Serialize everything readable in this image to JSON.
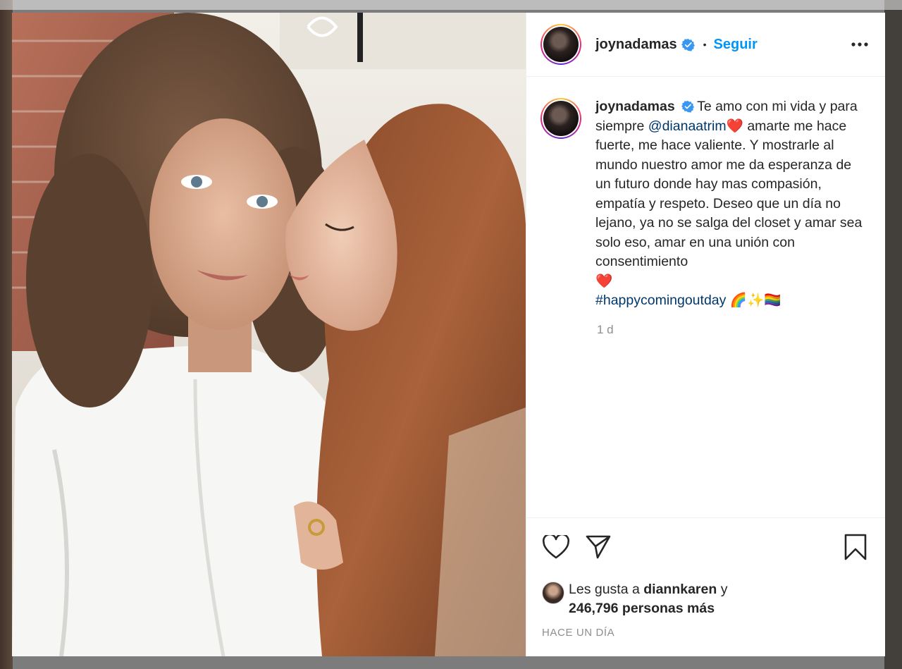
{
  "post": {
    "username": "joynadamas",
    "follow_label": "Seguir",
    "separator": "•",
    "caption": {
      "part1": "Te amo con mi vida y para siempre ",
      "mention": "@dianaatrim",
      "heart1": "❤️",
      "part2": " amarte me hace fuerte, me hace valiente. Y mostrarle al mundo nuestro amor me da esperanza de un futuro donde hay mas compasión, empatía y respeto. Deseo que un día no lejano, ya no se salga del closet y amar sea solo eso, amar en una unión con consentimiento",
      "heart2": "❤️",
      "hashtag": "#happycomingoutday",
      "emojis": "🌈✨🏳️‍🌈"
    },
    "caption_time": "1 d",
    "likes": {
      "prefix": "Les gusta a",
      "liker": "diannkaren",
      "connector": "y",
      "count_text": "246,796 personas más"
    },
    "posted_ago": "HACE UN DÍA"
  },
  "icons": {
    "verified": "verified-badge-icon",
    "more": "more-options-icon",
    "like": "heart-icon",
    "share": "paper-plane-icon",
    "save": "bookmark-icon"
  },
  "colors": {
    "accent": "#0095f6",
    "link": "#00376b",
    "text": "#262626",
    "muted": "#8e8e8e",
    "verified": "#3897f0"
  }
}
